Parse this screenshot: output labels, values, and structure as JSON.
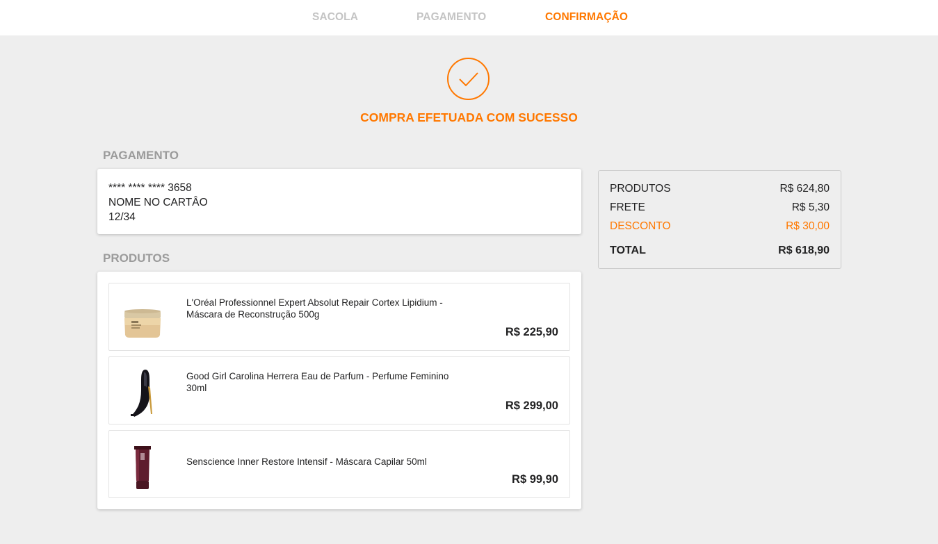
{
  "steps": {
    "bag": "SACOLA",
    "payment": "PAGAMENTO",
    "confirmation": "CONFIRMAÇÃO",
    "active": "confirmation"
  },
  "success": {
    "title": "COMPRA EFETUADA COM SUCESSO",
    "icon": "check-circle-icon"
  },
  "payment": {
    "section_title": "PAGAMENTO",
    "card_number": "**** **** **** 3658",
    "card_name": "NOME NO CARTÂO",
    "expiry": "12/34"
  },
  "products": {
    "section_title": "PRODUTOS",
    "items": [
      {
        "name": "L'Oréal Professionnel Expert Absolut Repair Cortex Lipidium - Máscara de Reconstrução 500g",
        "price": "R$ 225,90",
        "image": "hair-mask-jar"
      },
      {
        "name": "Good Girl Carolina Herrera Eau de Parfum - Perfume Feminino 30ml",
        "price": "R$ 299,00",
        "image": "perfume-stiletto-bottle"
      },
      {
        "name": "Senscience Inner Restore Intensif - Máscara Capilar 50ml",
        "price": "R$ 99,90",
        "image": "hair-mask-tube"
      }
    ]
  },
  "summary": {
    "products_label": "PRODUTOS",
    "products_value": "R$ 624,80",
    "shipping_label": "FRETE",
    "shipping_value": "R$ 5,30",
    "discount_label": "DESCONTO",
    "discount_value": "R$ 30,00",
    "total_label": "TOTAL",
    "total_value": "R$ 618,90"
  },
  "colors": {
    "accent": "#ff7800",
    "muted": "#c4c4c4",
    "section_title": "#9b9b9b",
    "background": "#eeeeee",
    "text": "#212122"
  }
}
